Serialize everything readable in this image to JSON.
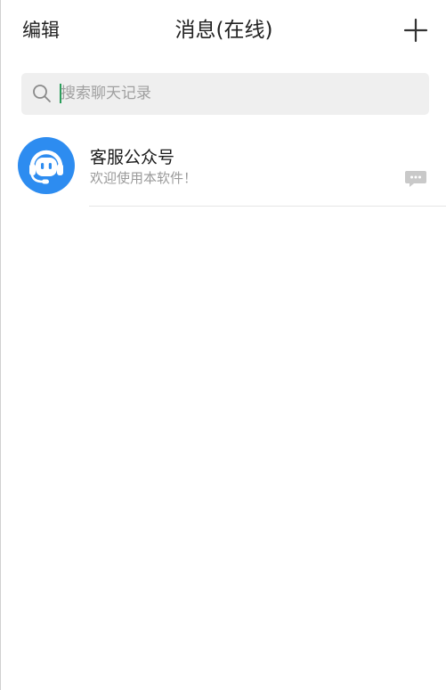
{
  "header": {
    "edit_label": "编辑",
    "title": "消息(在线)",
    "add_icon": "plus-icon"
  },
  "search": {
    "icon": "search-icon",
    "placeholder": "搜索聊天记录",
    "value": ""
  },
  "conversations": [
    {
      "name": "客服公众号",
      "preview": "欢迎使用本软件！",
      "avatar_icon": "headset-support-icon",
      "avatar_color": "#2d8cf0",
      "status_icon": "chat-bubble-icon"
    }
  ],
  "colors": {
    "accent": "#2d8cf0",
    "cursor": "#2a9d5a",
    "search_bg": "#efefef"
  }
}
